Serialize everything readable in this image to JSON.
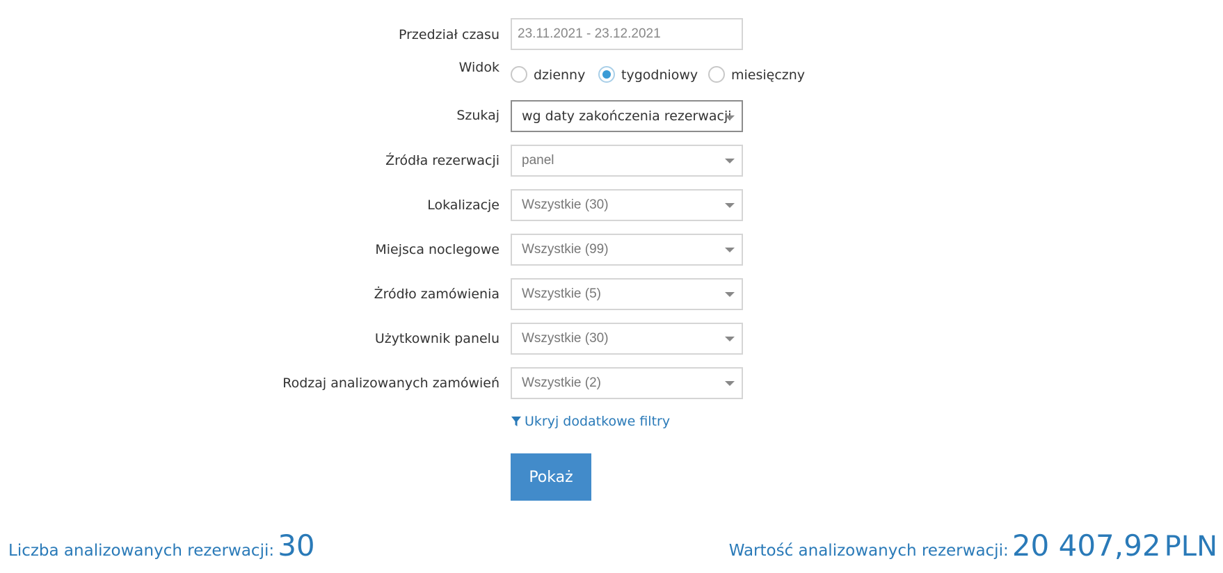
{
  "form": {
    "date_range": {
      "label": "Przedział czasu",
      "value": "23.11.2021 - 23.12.2021"
    },
    "view": {
      "label": "Widok",
      "options": [
        "dzienny",
        "tygodniowy",
        "miesięczny"
      ],
      "selected": "tygodniowy"
    },
    "search": {
      "label": "Szukaj",
      "value": "wg daty zakończenia rezerwacji"
    },
    "booking_sources": {
      "label": "Źródła rezerwacji",
      "value": "panel"
    },
    "locations": {
      "label": "Lokalizacje",
      "value": "Wszystkie (30)"
    },
    "accommodations": {
      "label": "Miejsca noclegowe",
      "value": "Wszystkie (99)"
    },
    "order_source": {
      "label": "Żródło zamówienia",
      "value": "Wszystkie (5)"
    },
    "panel_user": {
      "label": "Użytkownik panelu",
      "value": "Wszystkie (30)"
    },
    "order_type": {
      "label": "Rodzaj analizowanych zamówień",
      "value": "Wszystkie (2)"
    },
    "hide_filters_label": "Ukryj dodatkowe filtry",
    "show_button_label": "Pokaż"
  },
  "summary": {
    "count_label": "Liczba analizowanych rezerwacji:",
    "count_value": "30",
    "value_label": "Wartość analizowanych rezerwacji:",
    "value_amount": "20 407,92",
    "value_currency": "PLN"
  },
  "colors": {
    "accent": "#2a7ab8",
    "button": "#428bca",
    "radio_checked": "#3a9bd6"
  }
}
